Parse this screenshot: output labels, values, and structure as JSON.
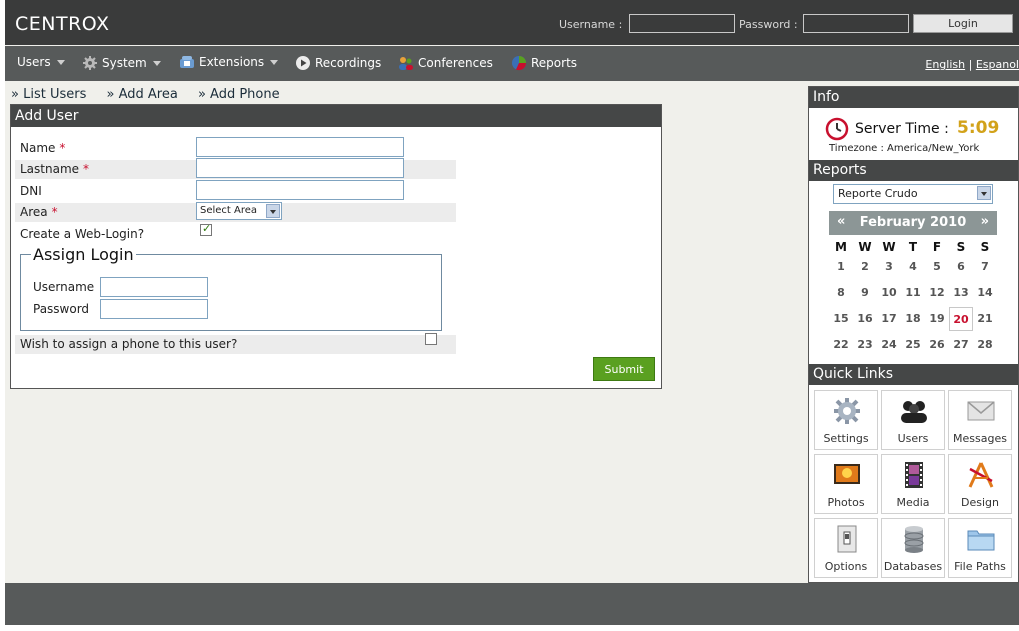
{
  "header": {
    "logo": "CENTROX",
    "username_label": "Username :",
    "password_label": "Password :",
    "login_label": "Login"
  },
  "nav": {
    "items": [
      {
        "label": "Users",
        "icon": "none",
        "has_caret": true
      },
      {
        "label": "System",
        "icon": "gear-icon",
        "has_caret": true
      },
      {
        "label": "Extensions",
        "icon": "phone-icon",
        "has_caret": true
      },
      {
        "label": "Recordings",
        "icon": "play-icon",
        "has_caret": false
      },
      {
        "label": "Conferences",
        "icon": "people-icon",
        "has_caret": false
      },
      {
        "label": "Reports",
        "icon": "pie-chart-icon",
        "has_caret": false
      }
    ],
    "lang_english": "English",
    "lang_separator": "|",
    "lang_spanish": "Espanol"
  },
  "breadcrumbs": {
    "list_users": "» List Users",
    "add_area": "» Add Area",
    "add_phone": "» Add Phone"
  },
  "form": {
    "title": "Add User",
    "name_label": "Name",
    "lastname_label": "Lastname",
    "dni_label": "DNI",
    "area_label": "Area",
    "required_mark": "*",
    "area_select_value": "Select Area",
    "web_login_label": "Create a Web-Login?",
    "web_login_checked": true,
    "assign_login_legend": "Assign Login",
    "username_label": "Username",
    "password_label": "Password",
    "assign_phone_label": "Wish to assign a phone to this user?",
    "assign_phone_checked": false,
    "submit_label": "Submit"
  },
  "sidebar": {
    "info_title": "Info",
    "server_time_label": "Server Time :",
    "server_time": "5:09",
    "timezone": "Timezone : America/New_York",
    "reports_title": "Reports",
    "report_select_value": "Reporte Crudo",
    "calendar": {
      "prev": "«",
      "next": "»",
      "title": "February 2010",
      "weekdays": [
        "M",
        "W",
        "W",
        "T",
        "F",
        "S",
        "S"
      ],
      "days": [
        [
          "1",
          "2",
          "3",
          "4",
          "5",
          "6",
          "7"
        ],
        [
          "8",
          "9",
          "10",
          "11",
          "12",
          "13",
          "14"
        ],
        [
          "15",
          "16",
          "17",
          "18",
          "19",
          "20",
          "21"
        ],
        [
          "22",
          "23",
          "24",
          "25",
          "26",
          "27",
          "28"
        ]
      ],
      "today": "20"
    },
    "quick_links_title": "Quick Links",
    "quick_links": [
      {
        "label": "Settings",
        "icon": "gear-icon"
      },
      {
        "label": "Users",
        "icon": "users-icon"
      },
      {
        "label": "Messages",
        "icon": "envelope-icon"
      },
      {
        "label": "Photos",
        "icon": "photo-icon"
      },
      {
        "label": "Media",
        "icon": "film-icon"
      },
      {
        "label": "Design",
        "icon": "design-icon"
      },
      {
        "label": "Options",
        "icon": "switch-icon"
      },
      {
        "label": "Databases",
        "icon": "database-icon"
      },
      {
        "label": "File Paths",
        "icon": "folder-icon"
      }
    ]
  },
  "colors": {
    "header_bg": "#3a3b3b",
    "nav_bg": "#575a5a",
    "submit_green": "#5aa020",
    "server_time_gold": "#d2a21a",
    "required_red": "#c8102e"
  }
}
